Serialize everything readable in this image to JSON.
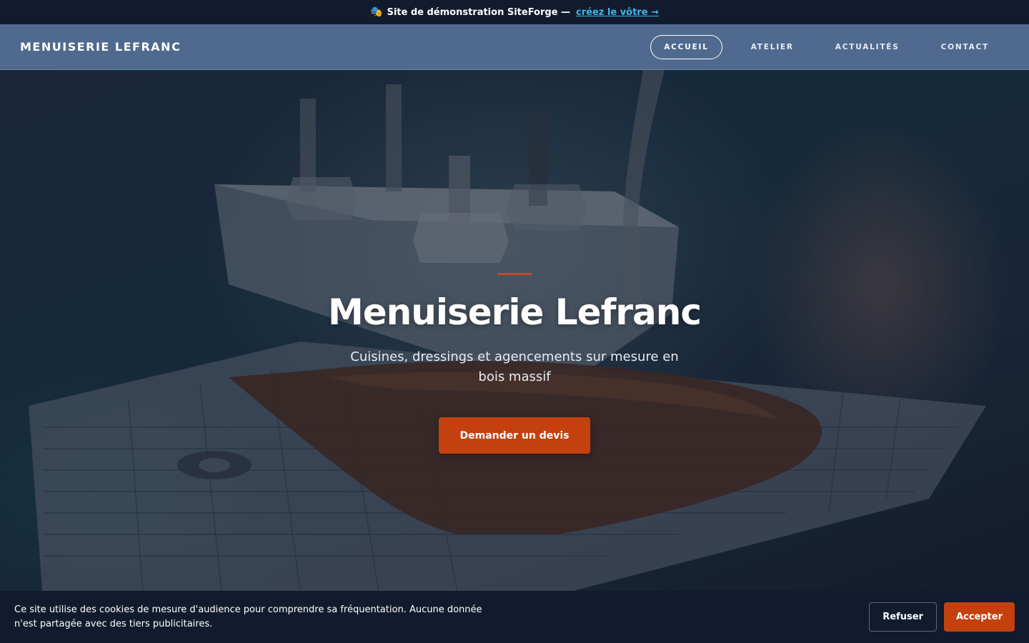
{
  "demo_banner": {
    "icon": "theater-masks-icon",
    "text": "Site de démonstration SiteForge —",
    "link_label": "créez le vôtre →",
    "link_color": "#3fb4e6"
  },
  "navbar": {
    "brand": "MENUISERIE LEFRANC",
    "background": "#4f6a8e",
    "items": [
      {
        "label": "ACCUEIL",
        "active": true
      },
      {
        "label": "ATELIER",
        "active": false
      },
      {
        "label": "ACTUALITÉS",
        "active": false
      },
      {
        "label": "CONTACT",
        "active": false
      }
    ]
  },
  "hero": {
    "title": "Menuiserie Lefranc",
    "subtitle": "Cuisines, dressings et agencements sur mesure en bois massif",
    "cta_label": "Demander un devis",
    "accent_color": "#c4410f"
  },
  "cookie_banner": {
    "text": "Ce site utilise des cookies de mesure d'audience pour comprendre sa fréquentation. Aucune donnée n'est partagée avec des tiers publicitaires.",
    "refuse_label": "Refuser",
    "accept_label": "Accepter"
  }
}
